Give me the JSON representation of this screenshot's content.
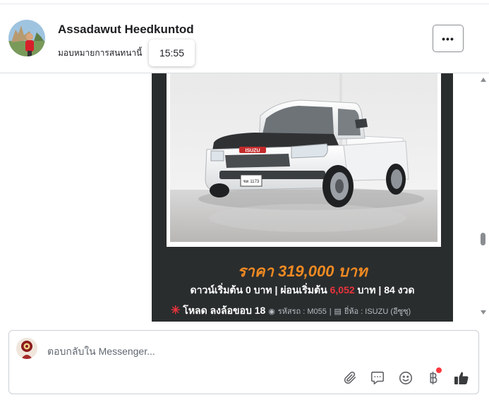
{
  "header": {
    "name": "Assadawut Heedkuntod",
    "subtitle": "มอบหมายการสนทนานี้",
    "tooltip_time": "15:55",
    "more_label": "•••"
  },
  "listing": {
    "plate_text": "ชต 1173",
    "brand_badge": "ISUZU",
    "price": "ราคา 319,000 บาท",
    "down_prefix": "ดาวน์เริ่มต้น 0 บาท | ผ่อนเริ่มต้น ",
    "installment": "6,052",
    "down_suffix": " บาท | 84 งวด",
    "star": "✳",
    "model": "โหลด ลงล้อขอบ 18",
    "code": "รหัสรถ : M055",
    "brand": "ยี่ห้อ : ISUZU (อีซูซุ)"
  },
  "composer": {
    "placeholder": "ตอบกลับใน Messenger..."
  },
  "icons": {
    "attach": "paperclip-icon",
    "saved_replies": "chat-bubble-icon",
    "emoji": "smiley-icon",
    "payment": "baht-icon",
    "like": "thumbs-up-icon"
  },
  "colors": {
    "card_bg": "#2a2d2e",
    "price": "#f08a22",
    "highlight_red": "#e8333d",
    "badge": "#fa383e",
    "icon": "#65676b"
  }
}
